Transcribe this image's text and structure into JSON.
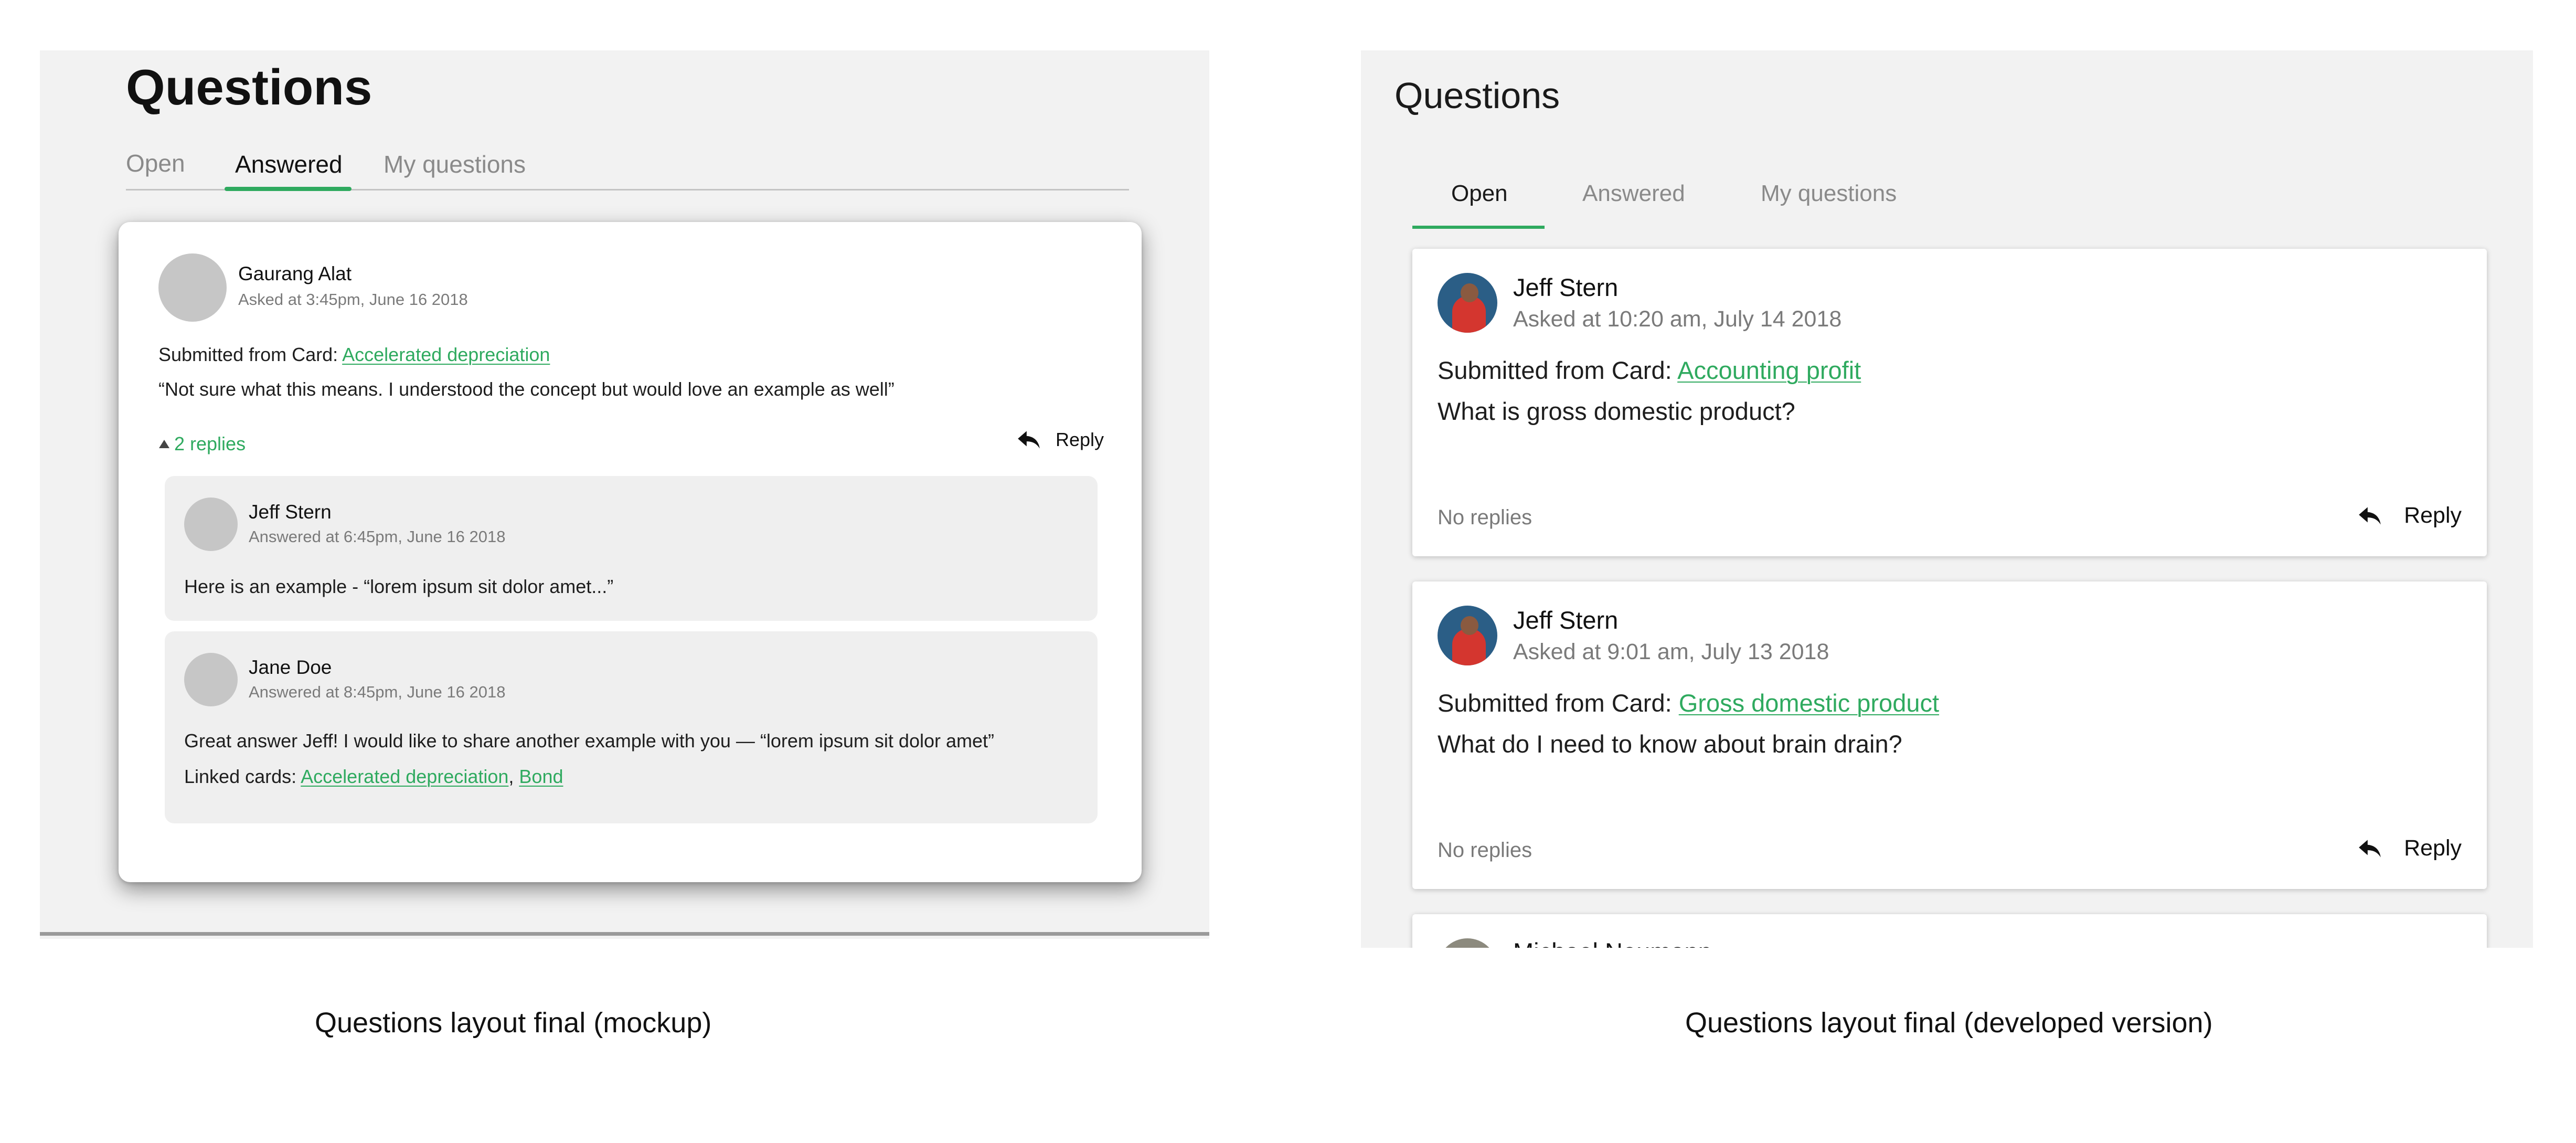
{
  "mockup": {
    "title": "Questions",
    "tabs": [
      {
        "label": "Open"
      },
      {
        "label": "Answered",
        "active": true
      },
      {
        "label": "My questions"
      }
    ],
    "question": {
      "author": "Gaurang Alat",
      "meta": "Asked at 3:45pm, June 16 2018",
      "submitted_prefix": "Submitted from Card:",
      "card_link": "Accelerated depreciation",
      "body": "“Not sure what this means. I understood the concept but would love an example as well”",
      "replies_toggle": "2 replies",
      "reply_label": "Reply"
    },
    "answers": [
      {
        "author": "Jeff Stern",
        "meta": "Answered at 6:45pm, June 16 2018",
        "body": "Here is an example - “lorem ipsum sit dolor amet...”"
      },
      {
        "author": "Jane Doe",
        "meta": "Answered at 8:45pm, June 16 2018",
        "body": "Great answer Jeff! I would like to share another example with you — “lorem ipsum sit dolor amet”",
        "linked_prefix": "Linked cards:",
        "linked_cards": [
          "Accelerated depreciation",
          "Bond"
        ],
        "linked_separator": ", "
      }
    ]
  },
  "developed": {
    "title": "Questions",
    "tabs": [
      {
        "label": "Open",
        "active": true
      },
      {
        "label": "Answered"
      },
      {
        "label": "My questions"
      }
    ],
    "questions": [
      {
        "author": "Jeff Stern",
        "meta": "Asked at 10:20 am, July 14 2018",
        "submitted_prefix": "Submitted from Card:",
        "card_link": "Accounting profit",
        "body": "What is gross domestic product?",
        "replies": "No replies",
        "reply_label": "Reply"
      },
      {
        "author": "Jeff Stern",
        "meta": "Asked at 9:01 am, July 13 2018",
        "submitted_prefix": "Submitted from Card:",
        "card_link": "Gross domestic product",
        "body": "What do I need to know about brain drain?",
        "replies": "No replies",
        "reply_label": "Reply"
      }
    ],
    "partial_author": "Michael Neumann"
  },
  "captions": {
    "left": "Questions layout final (mockup)",
    "right": "Questions layout final (developed version)"
  },
  "colors": {
    "accent_green": "#2faa5f",
    "panel_bg": "#f2f2f2",
    "reply_bg": "#efefef"
  },
  "icons": {
    "reply": "reply-arrow-icon",
    "expand": "triangle-up-icon",
    "avatar_placeholder": "avatar-placeholder"
  }
}
